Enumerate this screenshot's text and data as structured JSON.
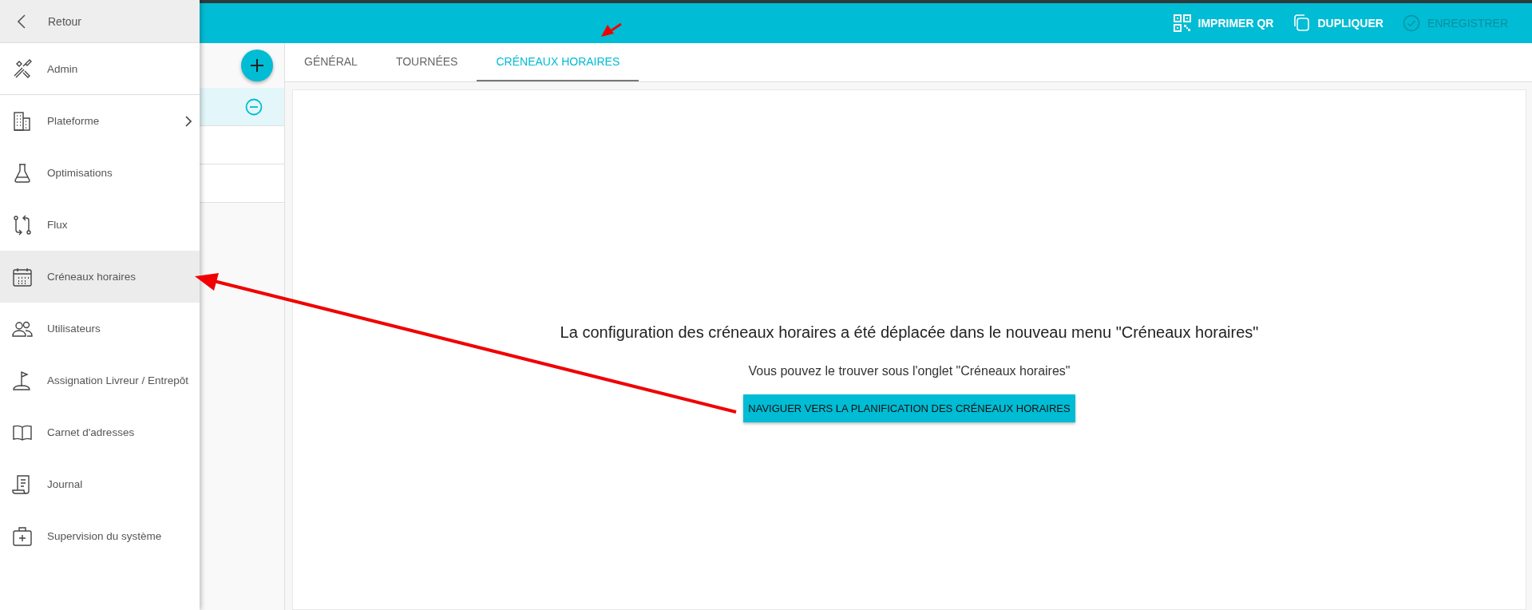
{
  "header": {
    "actions": [
      {
        "label": "IMPRIMER QR",
        "kind": "qr",
        "disabled": false
      },
      {
        "label": "DUPLIQUER",
        "kind": "copy",
        "disabled": false
      },
      {
        "label": "ENREGISTRER",
        "kind": "check",
        "disabled": true
      }
    ]
  },
  "drawer": {
    "back": {
      "label": "Retour"
    },
    "items": [
      {
        "label": "Admin",
        "kind": "tools",
        "selected": false,
        "has_submenu": false,
        "divider_after": true
      },
      {
        "label": "Plateforme",
        "kind": "building",
        "selected": false,
        "has_submenu": true,
        "divider_after": false
      },
      {
        "label": "Optimisations",
        "kind": "flask",
        "selected": false,
        "has_submenu": false,
        "divider_after": false
      },
      {
        "label": "Flux",
        "kind": "flow",
        "selected": false,
        "has_submenu": false,
        "divider_after": false
      },
      {
        "label": "Créneaux horaires",
        "kind": "calendar",
        "selected": true,
        "has_submenu": false,
        "divider_after": false
      },
      {
        "label": "Utilisateurs",
        "kind": "users",
        "selected": false,
        "has_submenu": false,
        "divider_after": false
      },
      {
        "label": "Assignation Livreur / Entrepôt",
        "kind": "flag",
        "selected": false,
        "has_submenu": false,
        "divider_after": false
      },
      {
        "label": "Carnet d'adresses",
        "kind": "book",
        "selected": false,
        "has_submenu": false,
        "divider_after": false
      },
      {
        "label": "Journal",
        "kind": "scroll",
        "selected": false,
        "has_submenu": false,
        "divider_after": false
      },
      {
        "label": "Supervision du système",
        "kind": "kit",
        "selected": false,
        "has_submenu": false,
        "divider_after": false
      }
    ]
  },
  "list_panel": {
    "rows": [
      {
        "selected": true
      },
      {
        "selected": false
      },
      {
        "selected": false
      }
    ]
  },
  "tabs": [
    {
      "label": "GÉNÉRAL",
      "selected": false
    },
    {
      "label": "TOURNÉES",
      "selected": false
    },
    {
      "label": "CRÉNEAUX HORAIRES",
      "selected": true
    }
  ],
  "content": {
    "title": "La configuration des créneaux horaires a été déplacée dans le nouveau menu \"Créneaux horaires\"",
    "subtitle": "Vous pouvez le trouver sous l'onglet \"Créneaux horaires\"",
    "button": "NAVIGUER VERS LA PLANIFICATION DES CRÉNEAUX HORAIRES"
  }
}
